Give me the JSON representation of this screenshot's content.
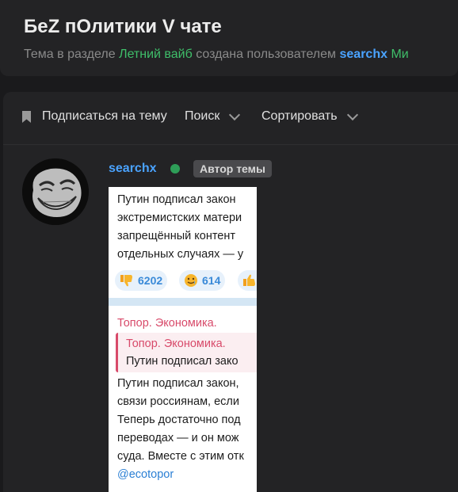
{
  "thread": {
    "title": "БеZ пОлитики V чате",
    "meta_prefix": "Тема в разделе",
    "section": "Летний вайб",
    "meta_mid": "созданa пользователем",
    "author": "searchx",
    "meta_cut": "Ми"
  },
  "toolbar": {
    "subscribe_label": "Подписаться на тему",
    "search_label": "Поиск",
    "sort_label": "Сортировать"
  },
  "post": {
    "author": "searchx",
    "author_badge": "Автор темы",
    "image": {
      "msg1_lines": [
        "Путин подписал закон",
        "экстремистских матери",
        "запрещённый контент",
        "отдельных случаях — у"
      ],
      "reactions": [
        {
          "icon": "thumbs-down-icon",
          "count": "6202"
        },
        {
          "icon": "smile-tear-icon",
          "count": "614"
        },
        {
          "icon": "thumbs-up-icon",
          "count": ""
        }
      ],
      "channel": "Топор. Экономика.",
      "quote_channel": "Топор. Экономика.",
      "quote_text": "Путин подписал зако",
      "msg2_lines": [
        "Путин подписал закон,",
        "связи россиянам, если",
        "Теперь достаточно под",
        "переводах — и он мож",
        "суда. Вместе с этим отк"
      ],
      "link": "@ecotopor"
    }
  }
}
